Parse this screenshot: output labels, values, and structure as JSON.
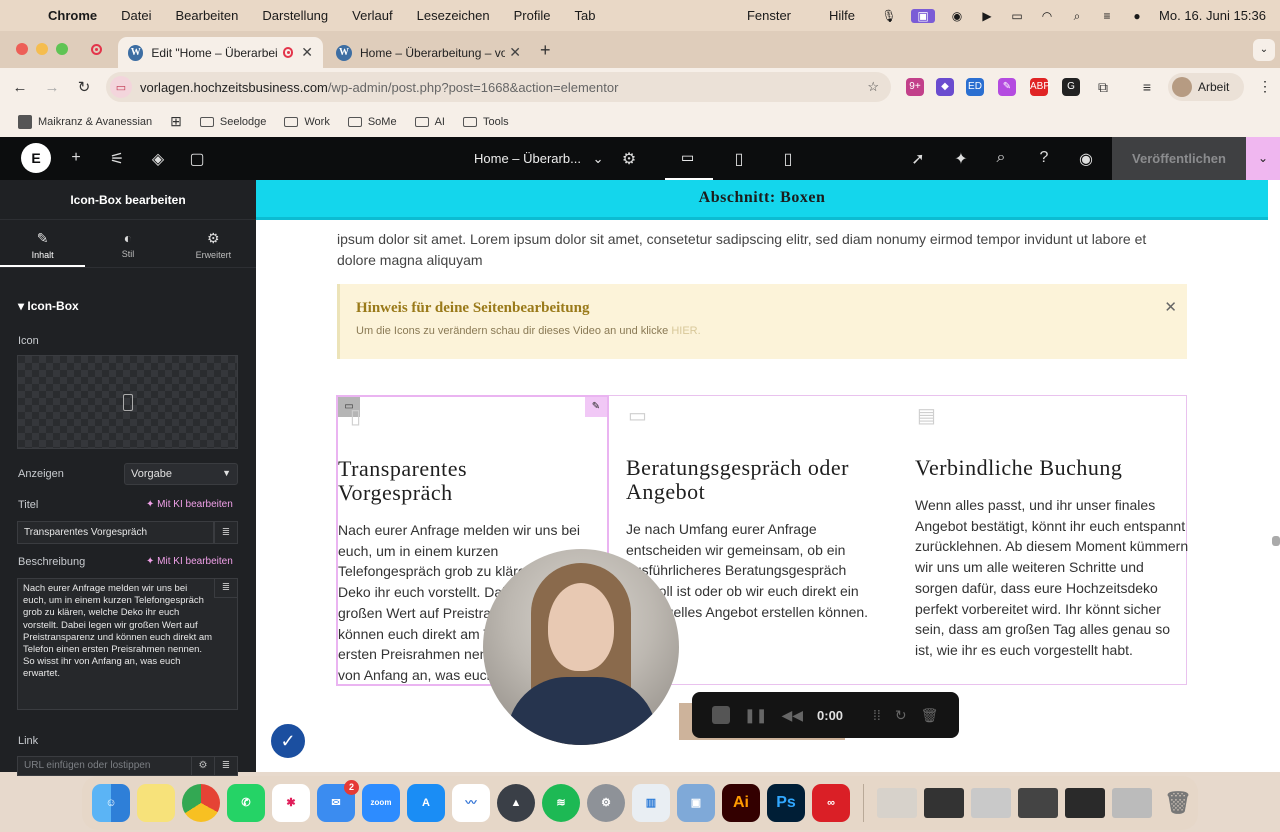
{
  "menubar": {
    "app": "Chrome",
    "items": [
      "Datei",
      "Bearbeiten",
      "Darstellung",
      "Verlauf",
      "Lesezeichen",
      "Profile",
      "Tab"
    ],
    "right_items": [
      "Fenster",
      "Hilfe"
    ],
    "clock": "Mo. 16. Juni 15:36"
  },
  "tabs": [
    {
      "title": "Edit \"Home – Überarbeitu"
    },
    {
      "title": "Home – Überarbeitung – vorl"
    }
  ],
  "toolbar": {
    "url_host": "vorlagen.hochzeitsbusiness.com",
    "url_path": "/wp-admin/post.php?post=1668&action=elementor",
    "profile_label": "Arbeit"
  },
  "bookmarks": [
    "Maikranz & Avanessian",
    "Seelodge",
    "Work",
    "SoMe",
    "AI",
    "Tools"
  ],
  "elementor": {
    "doc_title": "Home – Überarb...",
    "publish_label": "Veröffentlichen"
  },
  "panel": {
    "title": "Icon-Box bearbeiten",
    "tabs": [
      {
        "label": "Inhalt",
        "icon": "pencil-icon"
      },
      {
        "label": "Stil",
        "icon": "half-circle-icon"
      },
      {
        "label": "Erweitert",
        "icon": "gear-icon"
      }
    ],
    "section": "Icon-Box",
    "icon_label": "Icon",
    "display_label": "Anzeigen",
    "display_value": "Vorgabe",
    "title_label": "Titel",
    "ai_edit": "Mit KI bearbeiten",
    "title_value": "Transparentes Vorgespräch",
    "description_label": "Beschreibung",
    "description_value": "Nach eurer Anfrage melden wir uns bei euch, um in einem kurzen Telefongespräch grob zu klären, welche Deko ihr euch vorstellt. Dabei legen wir großen Wert auf Preistransparenz und können euch direkt am Telefon einen ersten Preisrahmen nennen. So wisst ihr von Anfang an, was euch erwartet.",
    "link_label": "Link",
    "link_placeholder": "URL einfügen oder lostippen"
  },
  "canvas": {
    "section_label": "Abschnitt: Boxen",
    "lorem": "ipsum dolor sit amet. Lorem ipsum dolor sit amet, consetetur sadipscing elitr, sed diam nonumy eirmod tempor invidunt ut labore et dolore magna aliquyam",
    "notice_heading": "Hinweis für deine Seitenbearbeitung",
    "notice_text": "Um die Icons zu verändern schau dir dieses Video an und klicke",
    "notice_link": "HIER.",
    "boxes": [
      {
        "title": "Transparentes Vorgespräch",
        "text": "Nach eurer Anfrage melden wir uns bei euch, um in einem kurzen Telefongespräch grob zu klären, welche Deko ihr euch vorstellt. Dabei legen wir großen Wert auf Preistransparenz und können euch direkt am Telefon einen ersten Preisrahmen nennen. So wisst ihr von Anfang an, was euch erwartet.",
        "icon": "phone-icon"
      },
      {
        "title": "Beratungsgespräch oder Angebot",
        "text": "Je nach Umfang eurer Anfrage entscheiden wir gemeinsam, ob ein ausführlicheres Beratungsgespräch sinnvoll ist oder ob wir euch direkt ein individuelles Angebot erstellen können.",
        "icon": "laptop-icon"
      },
      {
        "title": "Verbindliche Buchung",
        "text": "Wenn alles passt, und ihr unser finales Angebot bestätigt, könnt ihr euch entspannt zurücklehnen. Ab diesem Moment kümmern wir uns um alle weiteren Schritte und sorgen dafür, dass eure Hochzeitsdeko perfekt vorbereitet wird. Ihr könnt sicher sein, dass am großen Tag alles genau so ist, wie ihr es euch vorgestellt habt.",
        "icon": "document-icon"
      }
    ]
  },
  "recorder": {
    "time": "0:00"
  },
  "dock": {
    "mail_badge": "2",
    "apps": [
      "finder",
      "notes",
      "chrome",
      "whatsapp",
      "slack",
      "mail",
      "zoom",
      "app-store",
      "freeform",
      "vpn",
      "spotify",
      "settings",
      "files",
      "preview",
      "illustrator",
      "photoshop",
      "creative-cloud"
    ]
  }
}
